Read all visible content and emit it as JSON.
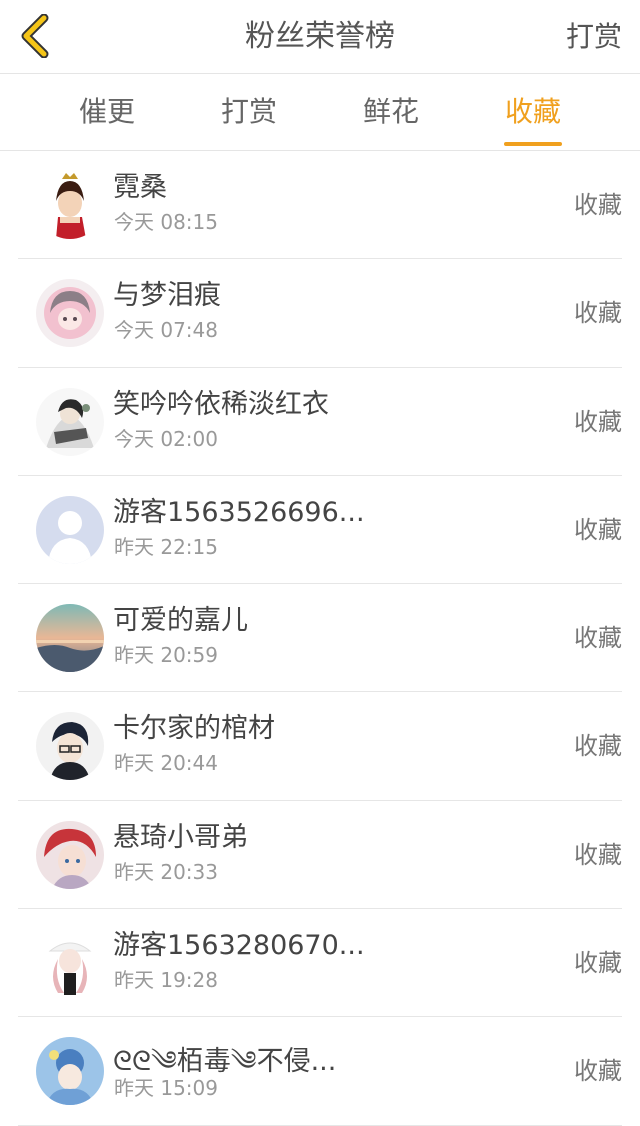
{
  "header": {
    "title": "粉丝荣誉榜",
    "right_action": "打赏"
  },
  "tabs": [
    {
      "label": "催更",
      "active": false
    },
    {
      "label": "打赏",
      "active": false
    },
    {
      "label": "鲜花",
      "active": false
    },
    {
      "label": "收藏",
      "active": true
    }
  ],
  "colors": {
    "accent": "#f0a01e"
  },
  "list": [
    {
      "name": "霓桑",
      "time": "今天 08:15",
      "action": "收藏"
    },
    {
      "name": "与梦泪痕",
      "time": "今天 07:48",
      "action": "收藏"
    },
    {
      "name": "笑吟吟依稀淡红衣",
      "time": "今天 02:00",
      "action": "收藏"
    },
    {
      "name": "游客1563526696...",
      "time": "昨天 22:15",
      "action": "收藏"
    },
    {
      "name": "可爱的嘉儿",
      "time": "昨天 20:59",
      "action": "收藏"
    },
    {
      "name": "卡尔家的棺材",
      "time": "昨天 20:44",
      "action": "收藏"
    },
    {
      "name": "悬琦小哥弟",
      "time": "昨天 20:33",
      "action": "收藏"
    },
    {
      "name": "游客1563280670...",
      "time": "昨天 19:28",
      "action": "收藏"
    },
    {
      "name": "ᘓᘓ༄栢毒༄不侵...",
      "time": "昨天 15:09",
      "action": "收藏"
    }
  ]
}
